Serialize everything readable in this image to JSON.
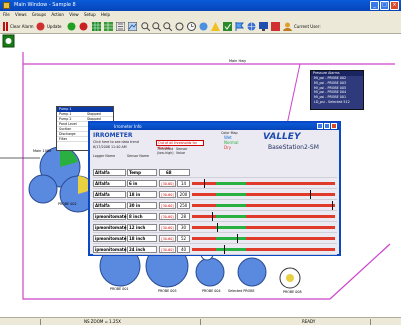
{
  "window": {
    "title": "Main Window - Sample 8"
  },
  "menu": [
    "File",
    "Views",
    "Groups",
    "Action",
    "View",
    "Setup",
    "Help"
  ],
  "toolbar": {
    "clear_alarm": "Clear Alarm",
    "update": "Update",
    "current_user": "Current User:"
  },
  "map": {
    "road_label": "Main Hwy",
    "main_label": "Main 1000",
    "probe_labels": [
      "PROBE 002",
      "PROBE 001",
      "PROBE 005",
      "PROBE 004",
      "Selected PROBE",
      "PROBE 008"
    ]
  },
  "listbox": {
    "title": "Pump 1",
    "rows": [
      {
        "name": "Pump 1",
        "status": "Stopped"
      },
      {
        "name": "Pump 2",
        "status": "Stopped"
      },
      {
        "name": "Pond Level",
        "status": ""
      },
      {
        "name": "Suction",
        "status": ""
      },
      {
        "name": "Discharge",
        "status": ""
      },
      {
        "name": "Filter",
        "status": ""
      }
    ]
  },
  "pressure": {
    "title": "Pressure Alarms",
    "rows": [
      "MI_psi - PROBE 002",
      "MI_psi - PROBE 003",
      "MI_psi - PROBE 005",
      "MI_psi - PROBE 004",
      "MI_psi - PROBE 001",
      "LD_psi - Selected 512"
    ]
  },
  "dialog": {
    "title": "Irrometer Info",
    "brand": "IRROMETER",
    "hint": "Click here to see data trend",
    "datetime": "6/17/2008 11:40 AM",
    "col_logger": "Logger Name",
    "col_sensor": "Sensor Name",
    "col_threshold": "Threshold (low-high)",
    "col_value": "Sensor Value",
    "out_of_thresholds": "Out of all thresholds for the tab",
    "color_map_title": "Color Map",
    "color_map": [
      "Wet",
      "Normal",
      "Dry"
    ],
    "valley": "VALLEY",
    "basestation": "BaseStation2-SM",
    "header": {
      "logger": "Alfalfa",
      "sensor": "Temp",
      "threshold": "",
      "value": "68"
    },
    "rows": [
      {
        "logger": "Alfalfa",
        "sensor": "6 in",
        "threshold": "[30-60]",
        "value": "14"
      },
      {
        "logger": "Alfalfa",
        "sensor": "18 in",
        "threshold": "[30-60]",
        "value": "200"
      },
      {
        "logger": "Alfalfa",
        "sensor": "30 in",
        "threshold": "[30-60]",
        "value": "250"
      },
      {
        "logger": "ipmonitomate",
        "sensor": "8 inch",
        "threshold": "[30-60]",
        "value": "28"
      },
      {
        "logger": "ipmonitomate",
        "sensor": "12 inch",
        "threshold": "[30-60]",
        "value": "30"
      },
      {
        "logger": "ipmonitomate",
        "sensor": "18 inch",
        "threshold": "[30-60]",
        "value": "52"
      },
      {
        "logger": "ipmonitomate",
        "sensor": "24 inch",
        "threshold": "[30-60]",
        "value": "40"
      }
    ]
  },
  "status": {
    "left": "NS ZOOM = 1.25X",
    "right": "READY"
  },
  "colors": {
    "titlebar": "#0a5ad8",
    "bar_red": "#e03a2a",
    "bar_green": "#2ab040",
    "circle": "#5a8ae0"
  }
}
